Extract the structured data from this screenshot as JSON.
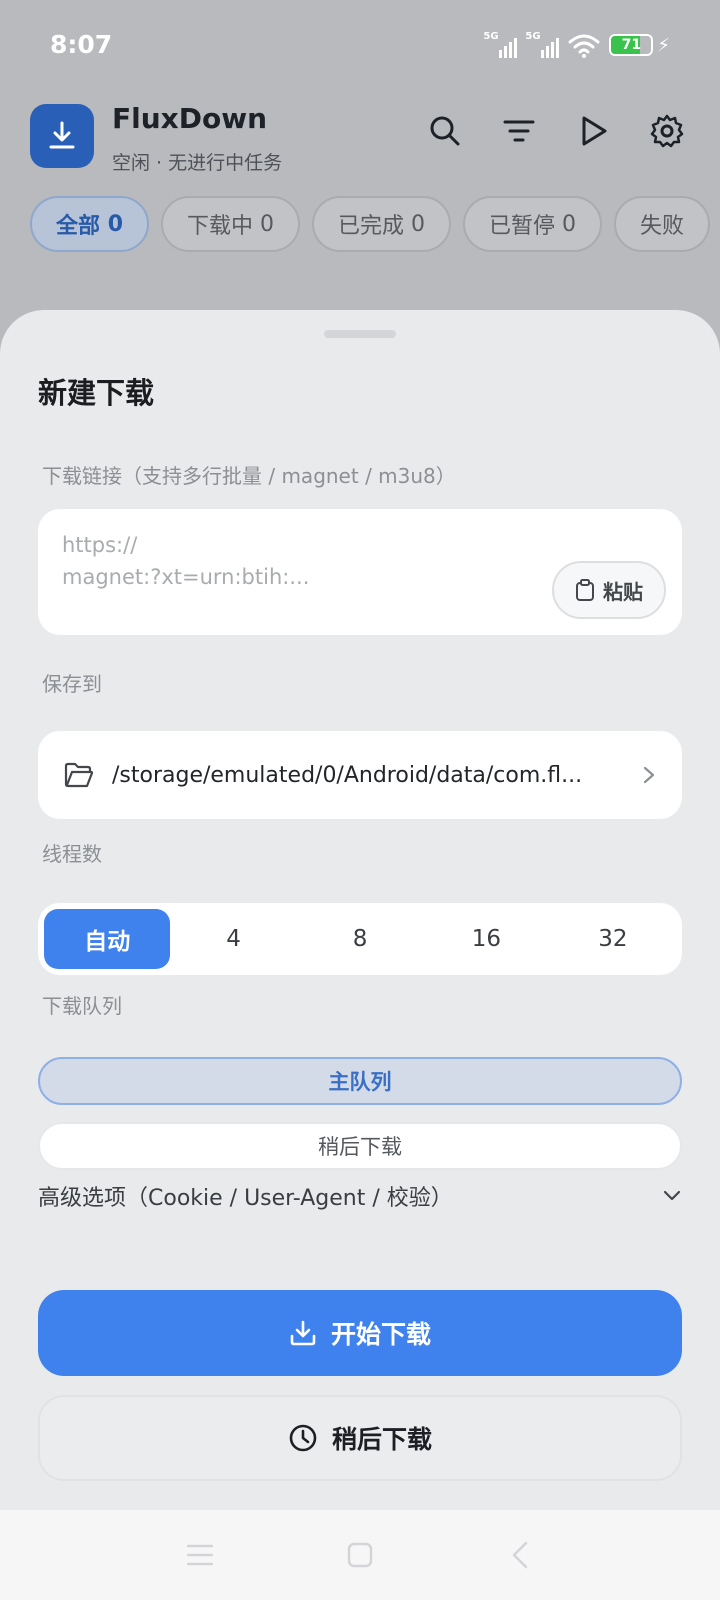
{
  "status_bar": {
    "time": "8:07",
    "signal_1_label": "5G",
    "signal_2_label": "5G",
    "battery_level": "71",
    "battery_fraction": 0.71,
    "colors": {
      "battery_fill": "#39c24c"
    }
  },
  "app": {
    "title": "FluxDown",
    "subtitle": "空闲 · 无进行中任务",
    "logo_icon": "download-icon",
    "actions": [
      "search-icon",
      "filter-icon",
      "play-icon",
      "gear-icon"
    ]
  },
  "filters": [
    {
      "label": "全部",
      "count": "0",
      "active": true
    },
    {
      "label": "下载中",
      "count": "0",
      "active": false
    },
    {
      "label": "已完成",
      "count": "0",
      "active": false
    },
    {
      "label": "已暂停",
      "count": "0",
      "active": false
    },
    {
      "label": "失败",
      "count": "",
      "active": false
    }
  ],
  "sheet": {
    "title": "新建下载",
    "url_section": {
      "label": "下载链接（支持多行批量 / magnet / m3u8）",
      "placeholder": "https://\nmagnet:?xt=urn:btih:...",
      "paste_label": "粘贴"
    },
    "save_section": {
      "label": "保存到",
      "path": "/storage/emulated/0/Android/data/com.fl..."
    },
    "threads_section": {
      "label": "线程数",
      "options": [
        "自动",
        "4",
        "8",
        "16",
        "32"
      ],
      "selected": "自动"
    },
    "queue_section": {
      "label": "下载队列",
      "options": [
        "主队列",
        "稍后下载"
      ],
      "selected": "主队列"
    },
    "advanced_label": "高级选项（Cookie / User-Agent / 校验）",
    "start_button": "开始下载",
    "later_button": "稍后下载"
  },
  "colors": {
    "accent": "#3f82ee",
    "logo": "#2a5fb8"
  }
}
